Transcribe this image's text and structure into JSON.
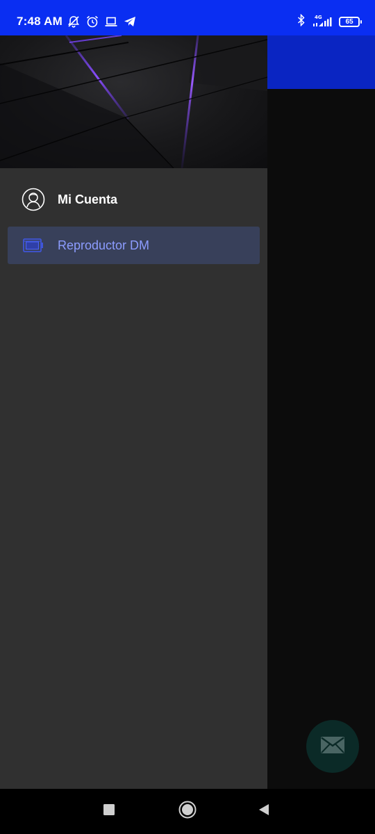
{
  "status_bar": {
    "time": "7:48 AM",
    "network": "4G",
    "battery": "65",
    "icons": [
      "mute-notifications-icon",
      "alarm-icon",
      "laptop-icon",
      "telegram-icon",
      "bluetooth-icon",
      "signal-icon",
      "battery-icon"
    ]
  },
  "drawer": {
    "items": [
      {
        "label": "Mi Cuenta",
        "icon": "account-icon",
        "active": false
      },
      {
        "label": "Reproductor DM",
        "icon": "player-icon",
        "active": true
      }
    ]
  },
  "fab": {
    "icon": "mail-icon"
  },
  "nav_bar": {
    "icons": [
      "recents-icon",
      "home-icon",
      "back-icon"
    ]
  },
  "colors": {
    "status_bar": "#0a2ef2",
    "toolbar": "#0a25c2",
    "drawer_bg": "#303030",
    "active_item_bg": "#38405a",
    "active_item_text": "#8c9cff",
    "fab_bg": "#0b2a27"
  }
}
